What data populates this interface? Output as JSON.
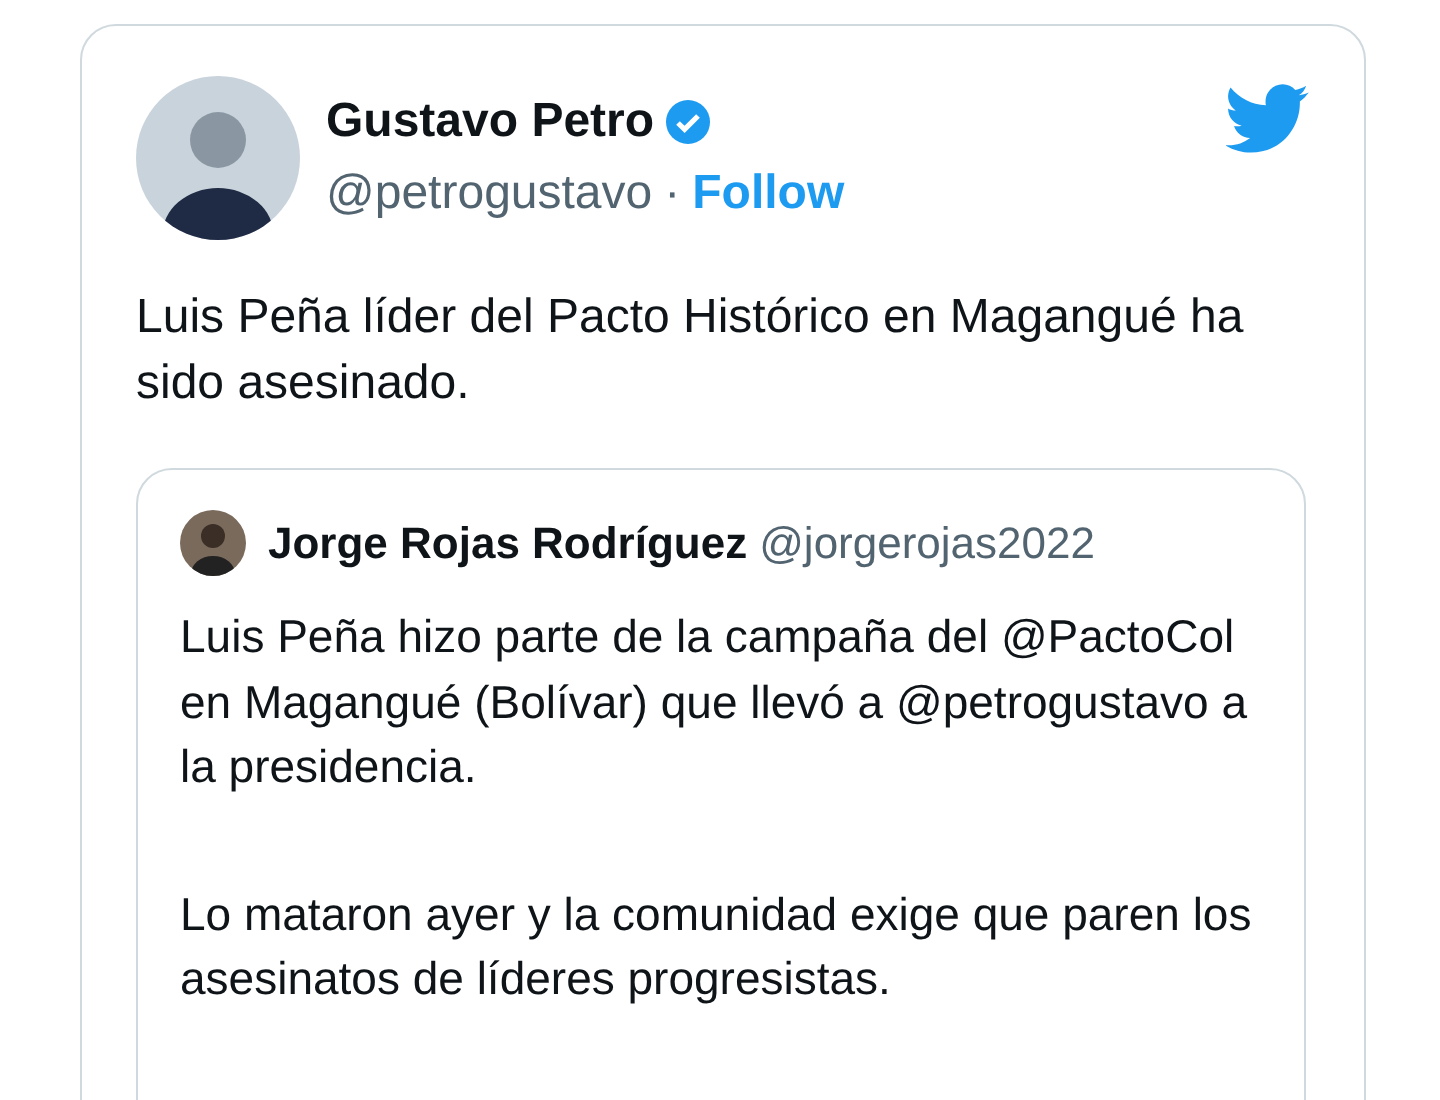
{
  "tweet": {
    "author": {
      "name": "Gustavo Petro",
      "verified": true,
      "handle": "@petrogustavo",
      "separator": "·",
      "follow": "Follow"
    },
    "text": "Luis Peña líder del Pacto Histórico en Magangué ha sido asesinado.",
    "quote": {
      "author": {
        "name": "Jorge Rojas Rodríguez",
        "handle": "@jorgerojas2022"
      },
      "paragraphs": [
        "Luis Peña hizo parte de la campaña del @PactoCol en Magangué (Bolívar) que llevó a @petrogustavo a la presidencia.",
        "Lo mataron ayer y la comunidad exige que paren los asesinatos de líderes progresistas."
      ]
    }
  }
}
